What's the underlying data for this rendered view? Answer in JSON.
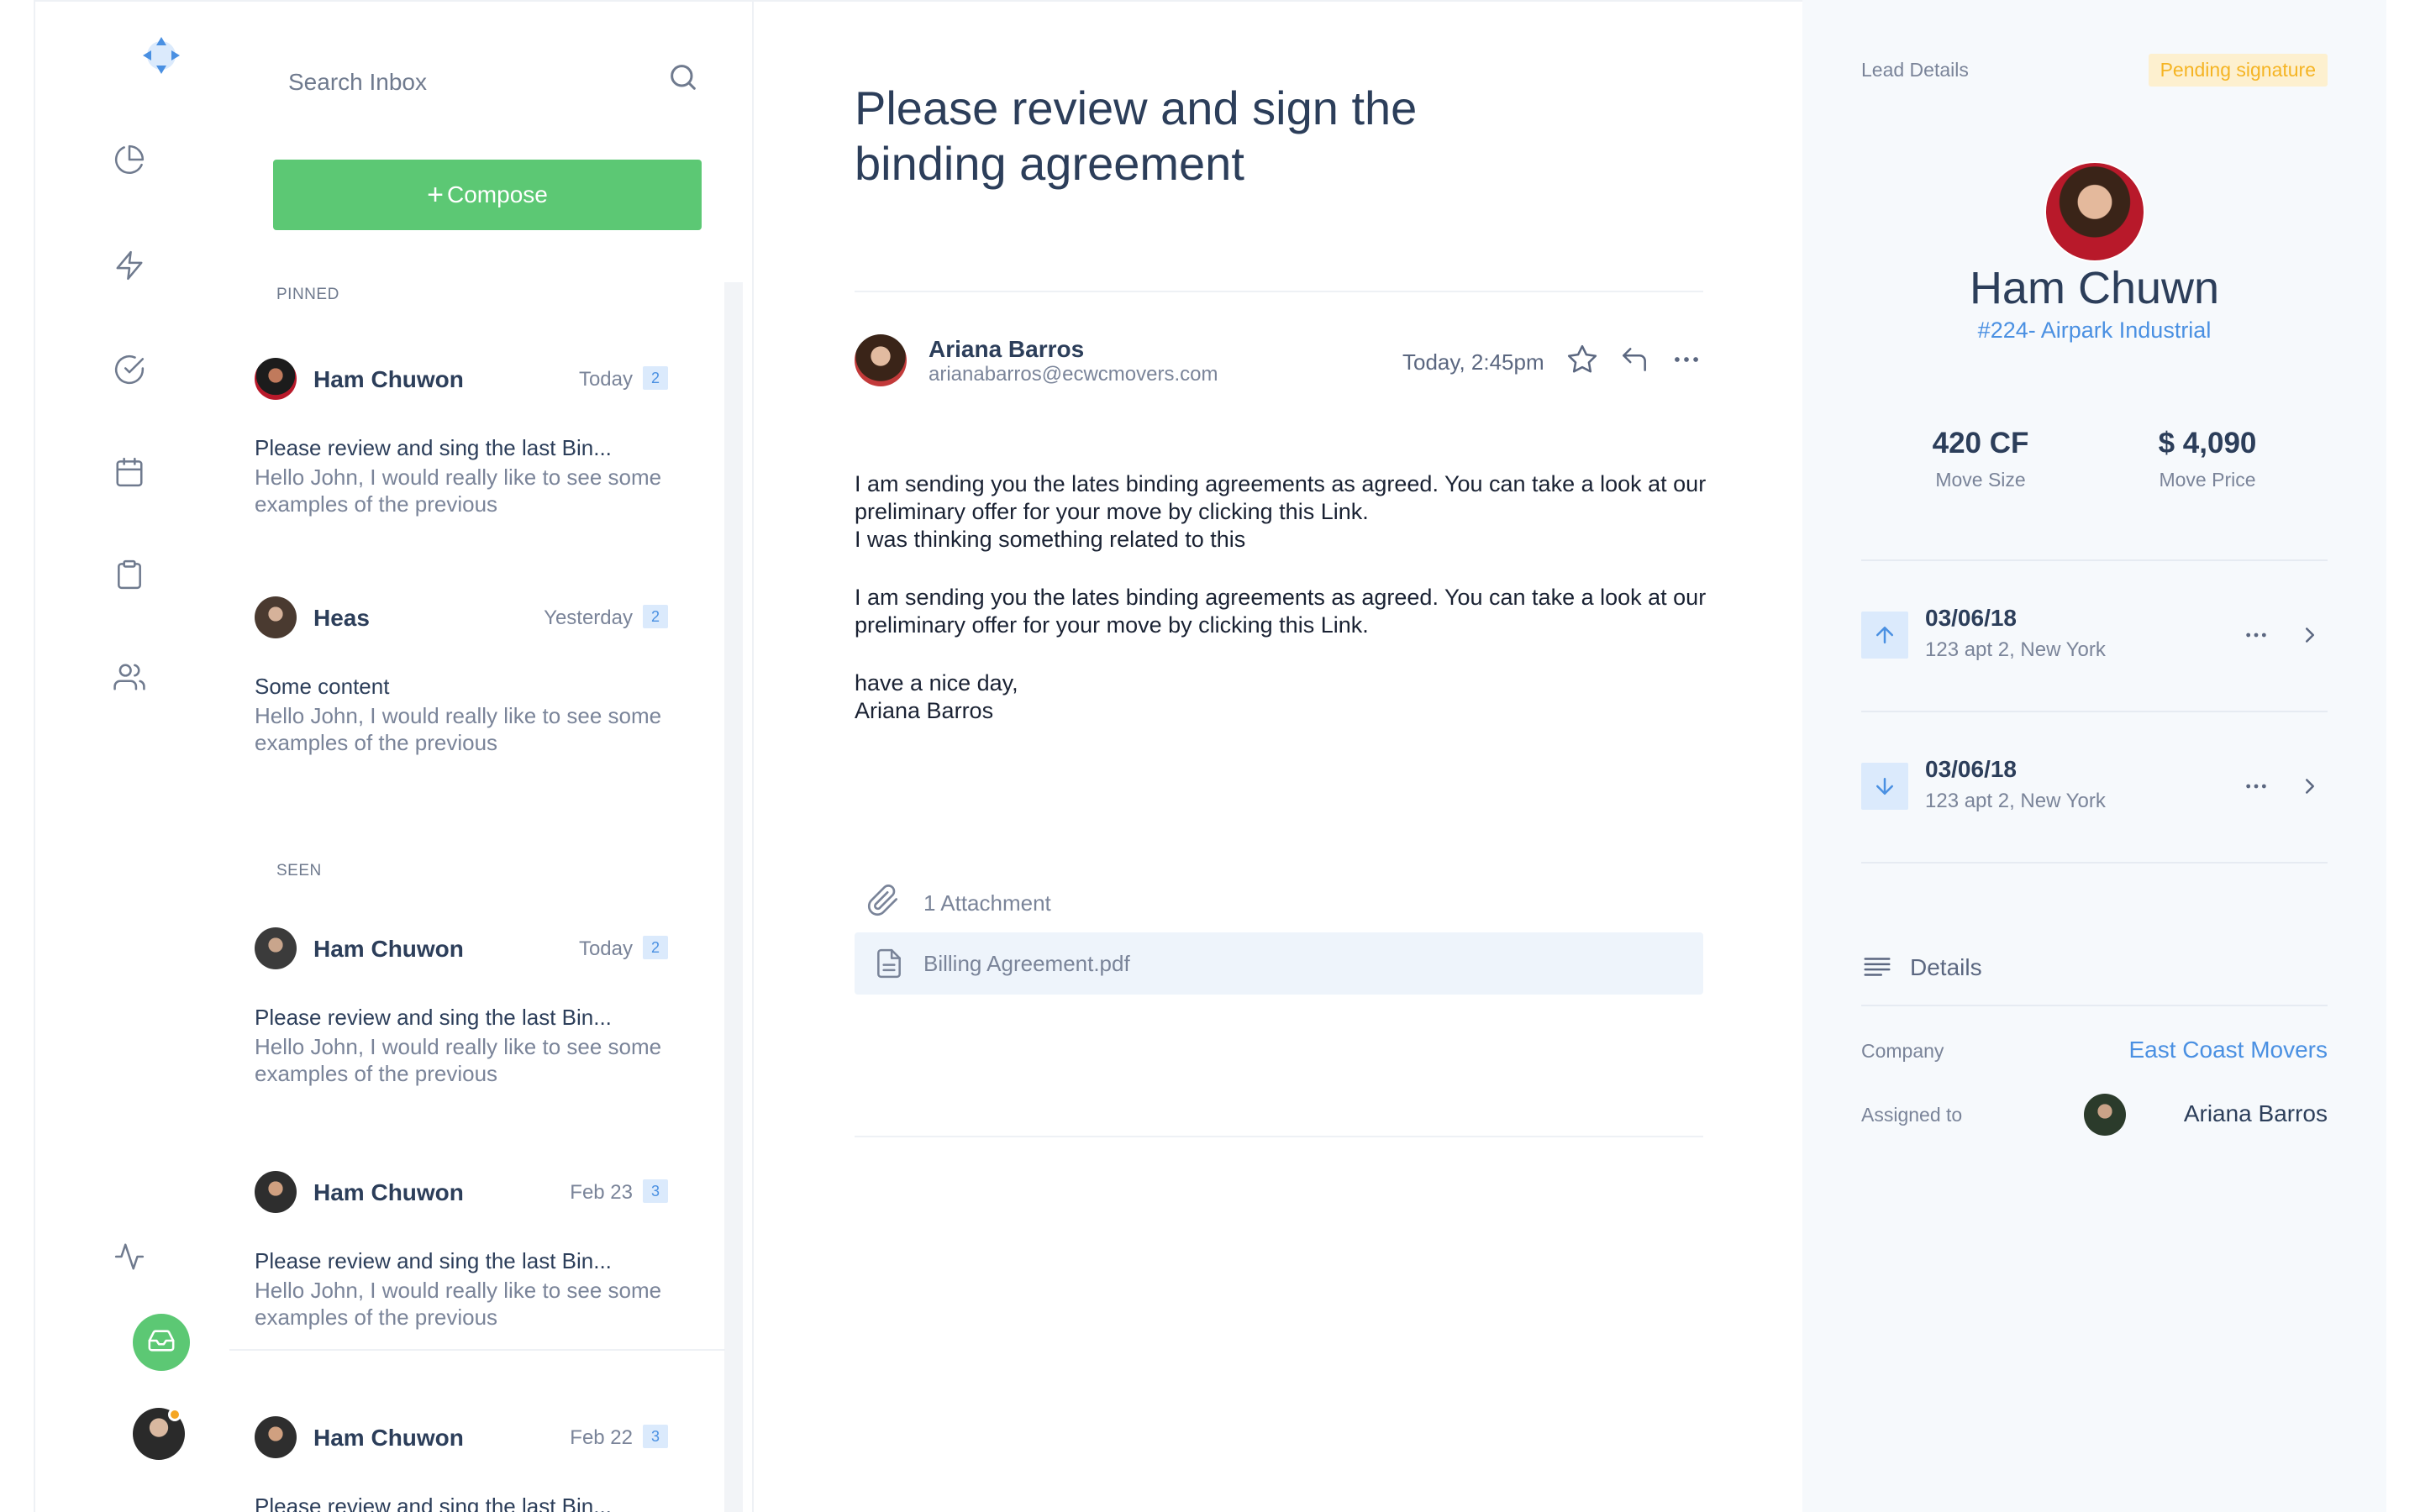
{
  "colors": {
    "accent_green": "#5cc874",
    "accent_blue": "#4a90e2",
    "status_yellow": "#f5b423",
    "text_dark": "#2c3e5a",
    "text_muted": "#7a8499"
  },
  "rail": {
    "logo_icon": "app-logo-icon",
    "nav": [
      {
        "icon": "pie-chart-icon"
      },
      {
        "icon": "lightning-icon"
      },
      {
        "icon": "check-circle-icon"
      },
      {
        "icon": "calendar-icon"
      },
      {
        "icon": "clipboard-icon"
      },
      {
        "icon": "users-icon"
      }
    ],
    "bottom": [
      {
        "icon": "activity-icon"
      },
      {
        "icon": "inbox-icon",
        "active": true
      }
    ]
  },
  "inbox": {
    "search_placeholder": "Search Inbox",
    "compose_label": "Compose",
    "pinned_label": "PINNED",
    "seen_label": "SEEN",
    "pinned": [
      {
        "sender": "Ham Chuwon",
        "date": "Today",
        "count": "2",
        "subject": "Please review and sing the last Bin...",
        "preview": "Hello John, I would really like to see some examples of the previous"
      },
      {
        "sender": "Heas",
        "date": "Yesterday",
        "count": "2",
        "subject": "Some content",
        "preview": "Hello John, I would really like to see some examples of the previous"
      }
    ],
    "seen": [
      {
        "sender": "Ham Chuwon",
        "date": "Today",
        "count": "2",
        "subject": "Please review and sing the last Bin...",
        "preview": "Hello John, I would really like to see some examples of the previous"
      },
      {
        "sender": "Ham Chuwon",
        "date": "Feb 23",
        "count": "3",
        "subject": "Please review and sing the last Bin...",
        "preview": "Hello John, I would really like to see some examples of the previous"
      },
      {
        "sender": "Ham Chuwon",
        "date": "Feb 22",
        "count": "3",
        "subject": "Please review and sing the last Bin..."
      }
    ]
  },
  "email": {
    "title": "Please review and sign the binding agreement",
    "from_name": "Ariana Barros",
    "from_email": "arianabarros@ecwcmovers.com",
    "time": "Today, 2:45pm",
    "body": {
      "p1_line1": "I am sending you the lates binding agreements as agreed. You can take a look at our preliminary offer for your move by clicking this Link.",
      "p1_line2": "I was thinking something related to this",
      "p2": "I am sending you the lates binding agreements as agreed. You can take a look at our preliminary offer for your move by clicking this Link.",
      "closing": "have a nice day,",
      "signature": "Ariana Barros"
    },
    "attachment_count_label": "1 Attachment",
    "attachment_file": "Billing Agreement.pdf"
  },
  "lead": {
    "label": "Lead Details",
    "status": "Pending signature",
    "name": "Ham Chuwn",
    "id_line": "#224- Airpark Industrial",
    "move_size_value": "420 CF",
    "move_size_label": "Move Size",
    "move_price_value": "$ 4,090",
    "move_price_label": "Move Price",
    "moves": [
      {
        "direction": "up",
        "date": "03/06/18",
        "address": "123 apt 2, New York"
      },
      {
        "direction": "down",
        "date": "03/06/18",
        "address": "123 apt 2, New York"
      }
    ],
    "details_label": "Details",
    "company_key": "Company",
    "company_value": "East Coast Movers",
    "assigned_key": "Assigned to",
    "assigned_value": "Ariana Barros"
  }
}
